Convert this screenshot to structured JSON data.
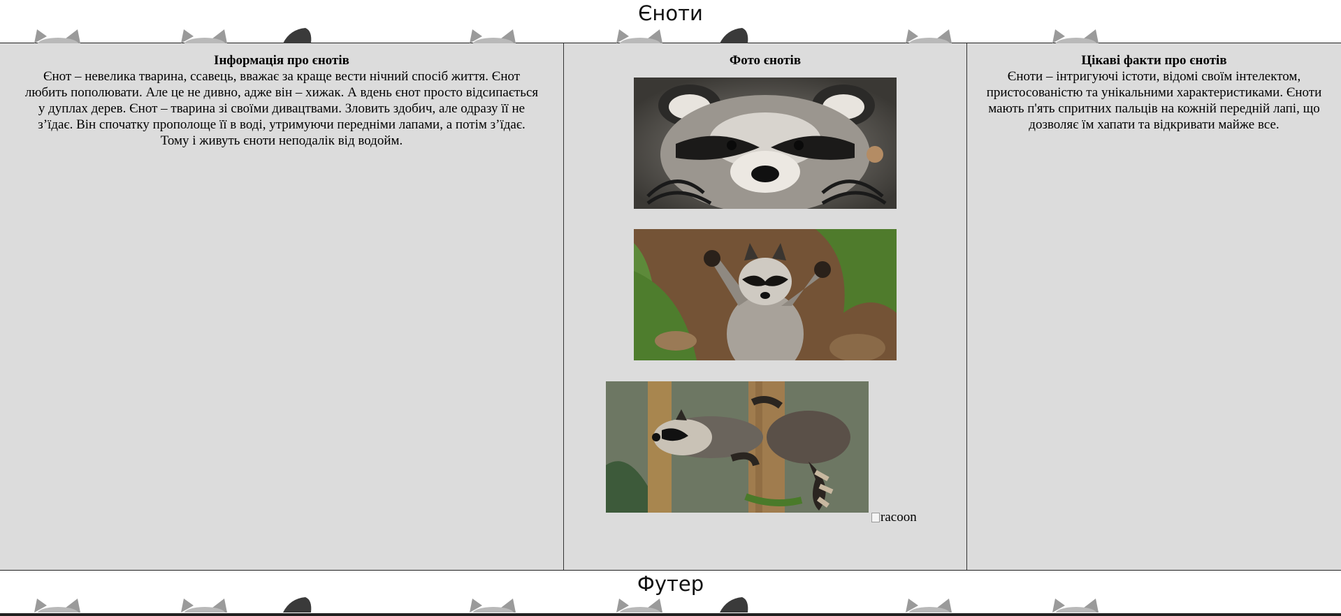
{
  "header": {
    "title": "Єноти"
  },
  "left_column": {
    "heading": "Інформація про єнотів",
    "lines": [
      "Єнот – невелика тварина, ссавець, вважає за краще вести нічний спосіб життя. Єнот",
      "любить пополювати. Але це не дивно, адже він – хижак. А вдень єнот просто відсипається",
      "у дуплах дерев. Єнот – тварина зі своїми дивацтвами. Зловить здобич, але одразу її не",
      "з’їдає. Він спочатку прополоще її в воді, утримуючи передніми лапами, а потім з’їдає.",
      "Тому і живуть єноти неподалік від водойм."
    ]
  },
  "middle_column": {
    "heading": "Фото єнотів",
    "photos": [
      {
        "subject": "raccoon face close-up"
      },
      {
        "subject": "raccoon standing with raised paws"
      },
      {
        "subject": "raccoon climbing a tree"
      }
    ],
    "broken_image_alt": "racoon"
  },
  "right_column": {
    "heading": "Цікаві факти про єнотів",
    "lines": [
      "Єноти – інтригуючі істоти, відомі своїм інтелектом,",
      "пристосованістю та унікальними характеристиками. Єноти",
      "мають п'ять спритних пальців на кожній передній лапі, що",
      "дозволяє їм хапати та відкривати майже все."
    ]
  },
  "footer": {
    "title": "Футер"
  },
  "colors": {
    "main_background": "#dcdcdc",
    "border": "#333333",
    "ear_gray": "#9a9a9a",
    "ear_dark": "#3a3a3a"
  }
}
